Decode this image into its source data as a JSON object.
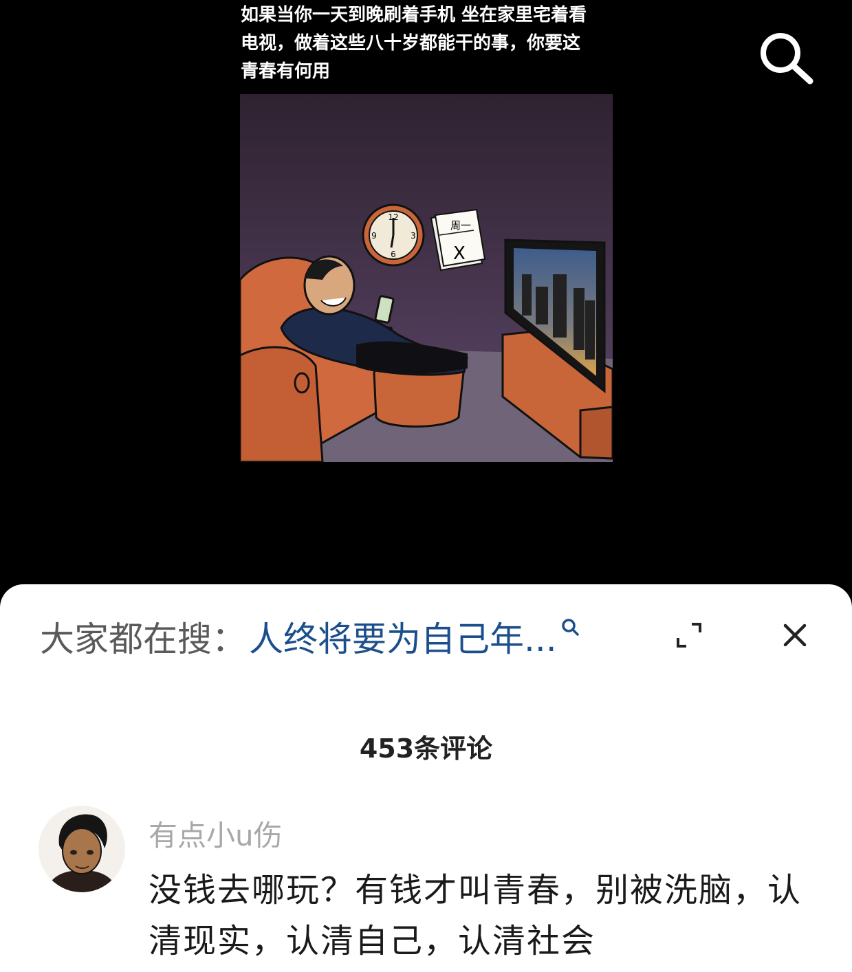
{
  "video": {
    "caption": "如果当你一天到晚刷着手机 坐在家里宅着看\n电视，做着这些八十岁都能干的事，你要这\n青春有何用",
    "comic": {
      "calendar_label": "周一",
      "calendar_mark": "X",
      "clock_numbers": [
        "12",
        "3",
        "6",
        "9"
      ]
    }
  },
  "search_suggest": {
    "prefix": "大家都在搜：",
    "query": "人终将要为自己年..."
  },
  "comments": {
    "count_label": "453条评论",
    "items": [
      {
        "username": "有点小u伤",
        "text": "没钱去哪玩？有钱才叫青春，别被洗脑，认清现实，认清自己，认清社会"
      }
    ]
  },
  "colors": {
    "sheet_bg": "#ffffff",
    "video_bg": "#000000",
    "link_blue": "#1b4f8c",
    "muted_gray": "#a8a8a8"
  },
  "icons": [
    "search-icon",
    "expand-icon",
    "close-icon",
    "magnifier-small-icon"
  ]
}
